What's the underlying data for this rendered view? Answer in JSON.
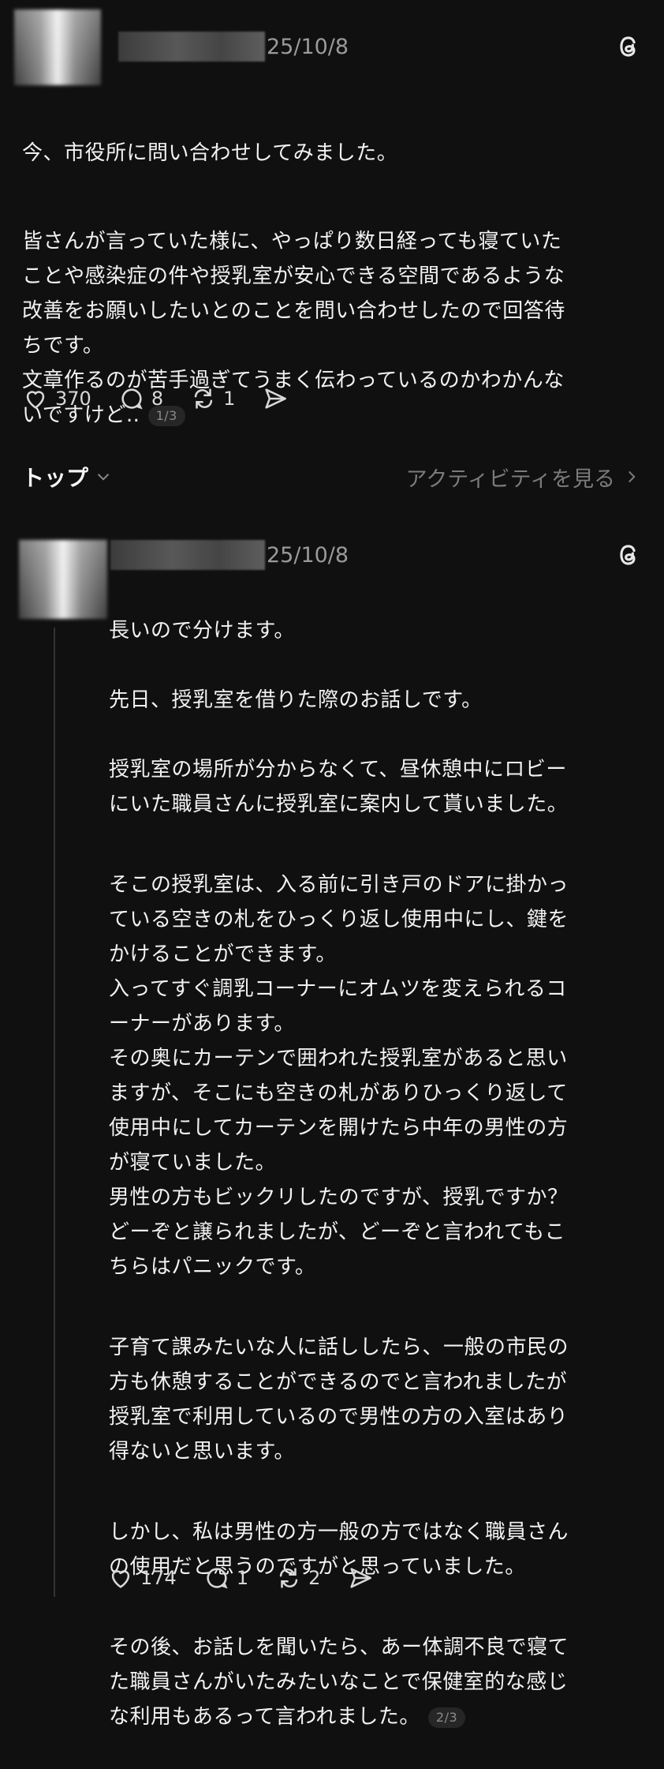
{
  "post": {
    "date": "25/10/8",
    "paragraphs": [
      "今、市役所に問い合わせしてみました。",
      "皆さんが言っていた様に、やっぱり数日経っても寝ていた\nことや感染症の件や授乳室が安心できる空間であるような\n改善をお願いしたいとのことを問い合わせしたので回答待\nちです。\n文章作るのが苦手過ぎてうまく伝わっているのかわかんな\nいですけど‥"
    ],
    "pager": "1/3",
    "likes": "370",
    "comments": "8",
    "reposts": "1"
  },
  "tabs": {
    "sort_label": "トップ",
    "activity_label": "アクティビティを見る"
  },
  "reply": {
    "date": "25/10/8",
    "paragraphs": [
      "長いので分けます。",
      "先日、授乳室を借りた際のお話しです。",
      "授乳室の場所が分からなくて、昼休憩中にロビー\nにいた職員さんに授乳室に案内して貰いました。",
      "そこの授乳室は、入る前に引き戸のドアに掛かっ\nている空きの札をひっくり返し使用中にし、鍵を\nかけることができます。\n入ってすぐ調乳コーナーにオムツを変えられるコ\nーナーがあります。\nその奥にカーテンで囲われた授乳室があると思い\nますが、そこにも空きの札がありひっくり返して\n使用中にしてカーテンを開けたら中年の男性の方\nが寝ていました。\n男性の方もビックリしたのですが、授乳ですか？\nどーぞと譲られましたが、どーぞと言われてもこ\nちらはパニックです。",
      "子育て課みたいな人に話ししたら、一般の市民の\n方も休憩することができるのでと言われましたが\n授乳室で利用しているので男性の方の入室はあり\n得ないと思います。",
      "しかし、私は男性の方一般の方ではなく職員さん\nの使用だと思うのですがと思っていました。",
      "その後、お話しを聞いたら、あー体調不良で寝て\nた職員さんがいたみたいなことで保健室的な感じ\nな利用もあるって言われました。"
    ],
    "pager": "2/3",
    "likes": "174",
    "comments": "1",
    "reposts": "2"
  }
}
